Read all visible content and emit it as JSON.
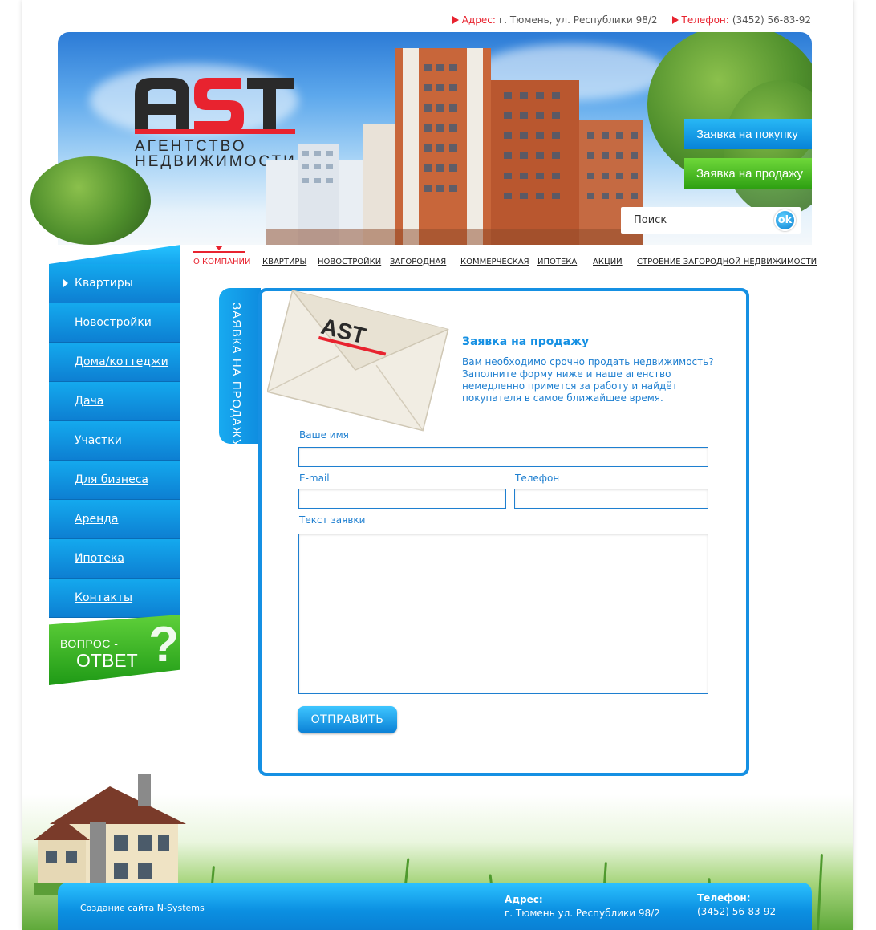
{
  "topinfo": {
    "address_label": "Адрес:",
    "address_value": "г. Тюмень, ул. Республики 98/2",
    "phone_label": "Телефон:",
    "phone_value": "(3452) 56-83-92"
  },
  "brand": {
    "logo_text": "AST",
    "subtitle_line1": "АГЕНТСТВО",
    "subtitle_line2": "НЕДВИЖИМОСТИ",
    "accent": "#e8232f",
    "primary": "#1590e3",
    "green": "#2ea012"
  },
  "header": {
    "buy_button": "Заявка на покупку",
    "sell_button": "Заявка на продажу",
    "search_placeholder": "Поиск",
    "search_button": "ok"
  },
  "topnav": [
    {
      "label": "О КОМПАНИИ",
      "active": true
    },
    {
      "label": "КВАРТИРЫ",
      "active": false
    },
    {
      "label": "НОВОСТРОЙКИ",
      "active": false
    },
    {
      "label": "ЗАГОРОДНАЯ",
      "active": false
    },
    {
      "label": "КОММЕРЧЕСКАЯ",
      "active": false
    },
    {
      "label": "ИПОТЕКА",
      "active": false
    },
    {
      "label": "АКЦИИ",
      "active": false
    },
    {
      "label": "СТРОЕНИЕ ЗАГОРОДНОЙ НЕДВИЖИМОСТИ",
      "active": false
    }
  ],
  "sidebar": {
    "items": [
      {
        "label": "Квартиры",
        "active": true
      },
      {
        "label": "Новостройки",
        "active": false
      },
      {
        "label": "Дома/коттеджи",
        "active": false
      },
      {
        "label": "Дача",
        "active": false
      },
      {
        "label": "Участки",
        "active": false
      },
      {
        "label": "Для бизнеса",
        "active": false
      },
      {
        "label": "Аренда",
        "active": false
      },
      {
        "label": "Ипотека",
        "active": false
      },
      {
        "label": "Контакты",
        "active": false
      }
    ],
    "faq_line1": "ВОПРОС -",
    "faq_line2": "ОТВЕТ",
    "faq_mark": "?"
  },
  "form": {
    "tab_label": "ЗАЯВКА НА ПРОДАЖУ",
    "envelope_logo": "AST",
    "title": "Заявка на продажу",
    "description": "Вам необходимо срочно продать недвижимость? Заполните форму ниже и наше агенство немедленно примется за работу и найдёт покупателя в самое ближайшее время.",
    "name_label": "Ваше имя",
    "name_value": "",
    "email_label": "E-mail",
    "email_value": "",
    "phone_label": "Телефон",
    "phone_value": "",
    "text_label": "Текст заявки",
    "text_value": "",
    "submit_label": "ОТПРАВИТЬ"
  },
  "footer": {
    "credit_prefix": "Создание сайта",
    "credit_link": "N-Systems",
    "address_label": "Адрес:",
    "address_value": "г. Тюмень  ул. Республики 98/2",
    "phone_label": "Телефон:",
    "phone_value": "(3452) 56-83-92"
  }
}
